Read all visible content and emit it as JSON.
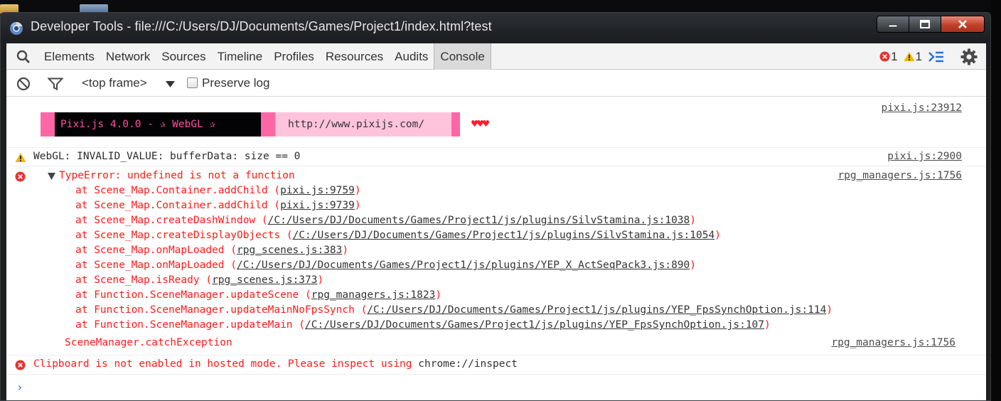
{
  "window": {
    "title": "Developer Tools - file:///C:/Users/DJ/Documents/Games/Project1/index.html?test"
  },
  "toolbar": {
    "tabs": [
      {
        "label": "Elements"
      },
      {
        "label": "Network"
      },
      {
        "label": "Sources"
      },
      {
        "label": "Timeline"
      },
      {
        "label": "Profiles"
      },
      {
        "label": "Resources"
      },
      {
        "label": "Audits"
      },
      {
        "label": "Console",
        "active": true
      }
    ],
    "error_count": "1",
    "warning_count": "1"
  },
  "subbar": {
    "frame_select": "<top frame>",
    "preserve_log_label": "Preserve log",
    "preserve_log_checked": false
  },
  "console": {
    "banner": {
      "title": "Pixi.js 4.0.0 - ✰ WebGL ✰",
      "url": "http://www.pixijs.com/",
      "hearts": "♥♥♥",
      "source": "pixi.js:23912"
    },
    "warning": {
      "text": "WebGL: INVALID_VALUE: bufferData: size == 0",
      "source": "pixi.js:2900"
    },
    "error": {
      "text": "TypeError: undefined is not a function",
      "source": "rpg_managers.js:1756",
      "stack": [
        {
          "fn": "at Scene_Map.Container.addChild",
          "loc": "pixi.js:9759"
        },
        {
          "fn": "at Scene_Map.Container.addChild",
          "loc": "pixi.js:9739"
        },
        {
          "fn": "at Scene_Map.createDashWindow",
          "loc": "/C:/Users/DJ/Documents/Games/Project1/js/plugins/SilvStamina.js:1038"
        },
        {
          "fn": "at Scene_Map.createDisplayObjects",
          "loc": "/C:/Users/DJ/Documents/Games/Project1/js/plugins/SilvStamina.js:1054"
        },
        {
          "fn": "at Scene_Map.onMapLoaded",
          "loc": "rpg_scenes.js:383"
        },
        {
          "fn": "at Scene_Map.onMapLoaded",
          "loc": "/C:/Users/DJ/Documents/Games/Project1/js/plugins/YEP_X_ActSeqPack3.js:890"
        },
        {
          "fn": "at Scene_Map.isReady",
          "loc": "rpg_scenes.js:373"
        },
        {
          "fn": "at Function.SceneManager.updateScene",
          "loc": "rpg_managers.js:1823"
        },
        {
          "fn": "at Function.SceneManager.updateMainNoFpsSynch",
          "loc": "/C:/Users/DJ/Documents/Games/Project1/js/plugins/YEP_FpsSynchOption.js:114"
        },
        {
          "fn": "at Function.SceneManager.updateMain",
          "loc": "/C:/Users/DJ/Documents/Games/Project1/js/plugins/YEP_FpsSynchOption.js:107"
        }
      ],
      "caller": "SceneManager.catchException",
      "caller_source": "rpg_managers.js:1756"
    },
    "error2": {
      "text": "Clipboard is not enabled in hosted mode. Please inspect using",
      "suffix": "chrome://inspect"
    },
    "prompt": "›"
  },
  "colors": {
    "error": "#ff1a1a",
    "warning": "#f5b400",
    "banner_pink": "#ff66a5",
    "banner_dark": "#030305",
    "banner_light": "#ffc3dc",
    "close_red": "#c2402b",
    "link_blue": "#2a6edb"
  },
  "icons": [
    "chrome-devtools-icon",
    "minimize-icon",
    "maximize-icon",
    "close-icon",
    "search-icon",
    "error-icon",
    "warning-icon",
    "drawer-toggle-icon",
    "gear-icon",
    "clear-console-icon",
    "filter-icon",
    "dropdown-arrow-icon",
    "prompt-icon"
  ]
}
